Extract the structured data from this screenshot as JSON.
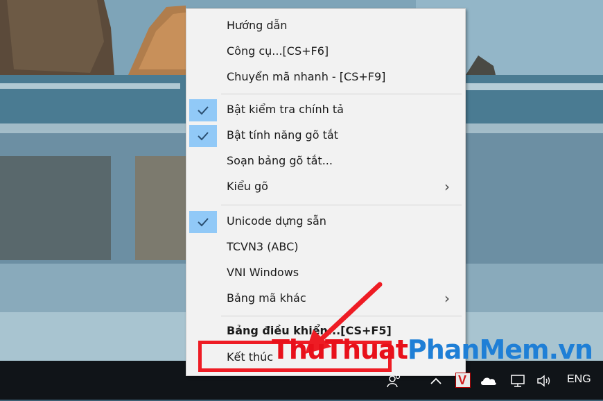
{
  "menu": {
    "items": [
      {
        "label": "Hướng dẫn",
        "checked": false,
        "submenu": false,
        "bold": false
      },
      {
        "label": "Công cụ...[CS+F6]",
        "checked": false,
        "submenu": false,
        "bold": false
      },
      {
        "label": "Chuyển mã nhanh - [CS+F9]",
        "checked": false,
        "submenu": false,
        "bold": false
      },
      {
        "label": "Bật kiểm tra chính tả",
        "checked": true,
        "submenu": false,
        "bold": false
      },
      {
        "label": "Bật tính năng gõ tắt",
        "checked": true,
        "submenu": false,
        "bold": false
      },
      {
        "label": "Soạn bảng gõ tắt...",
        "checked": false,
        "submenu": false,
        "bold": false
      },
      {
        "label": "Kiểu gõ",
        "checked": false,
        "submenu": true,
        "bold": false
      },
      {
        "label": "Unicode dựng sẵn",
        "checked": true,
        "submenu": false,
        "bold": false
      },
      {
        "label": "TCVN3 (ABC)",
        "checked": false,
        "submenu": false,
        "bold": false
      },
      {
        "label": "VNI Windows",
        "checked": false,
        "submenu": false,
        "bold": false
      },
      {
        "label": "Bảng mã khác",
        "checked": false,
        "submenu": true,
        "bold": false
      },
      {
        "label": "Bảng điều khiển...[CS+F5]",
        "checked": false,
        "submenu": false,
        "bold": true
      },
      {
        "label": "Kết thúc",
        "checked": false,
        "submenu": false,
        "bold": false
      }
    ],
    "submenu_arrow": "›"
  },
  "watermark": {
    "part1": "ThuThuat",
    "part2": "PhanMem.vn"
  },
  "tray": {
    "vietkey_letter": "V",
    "language": "ENG",
    "icons": [
      "people-icon",
      "chevron-up-icon",
      "vietkey-icon",
      "onedrive-cloud-icon",
      "network-icon",
      "volume-icon"
    ]
  },
  "colors": {
    "check_highlight": "#91c9f7",
    "annotation_red": "#ee1c24",
    "watermark_red": "#e8101a",
    "watermark_blue": "#1f7fd6"
  }
}
